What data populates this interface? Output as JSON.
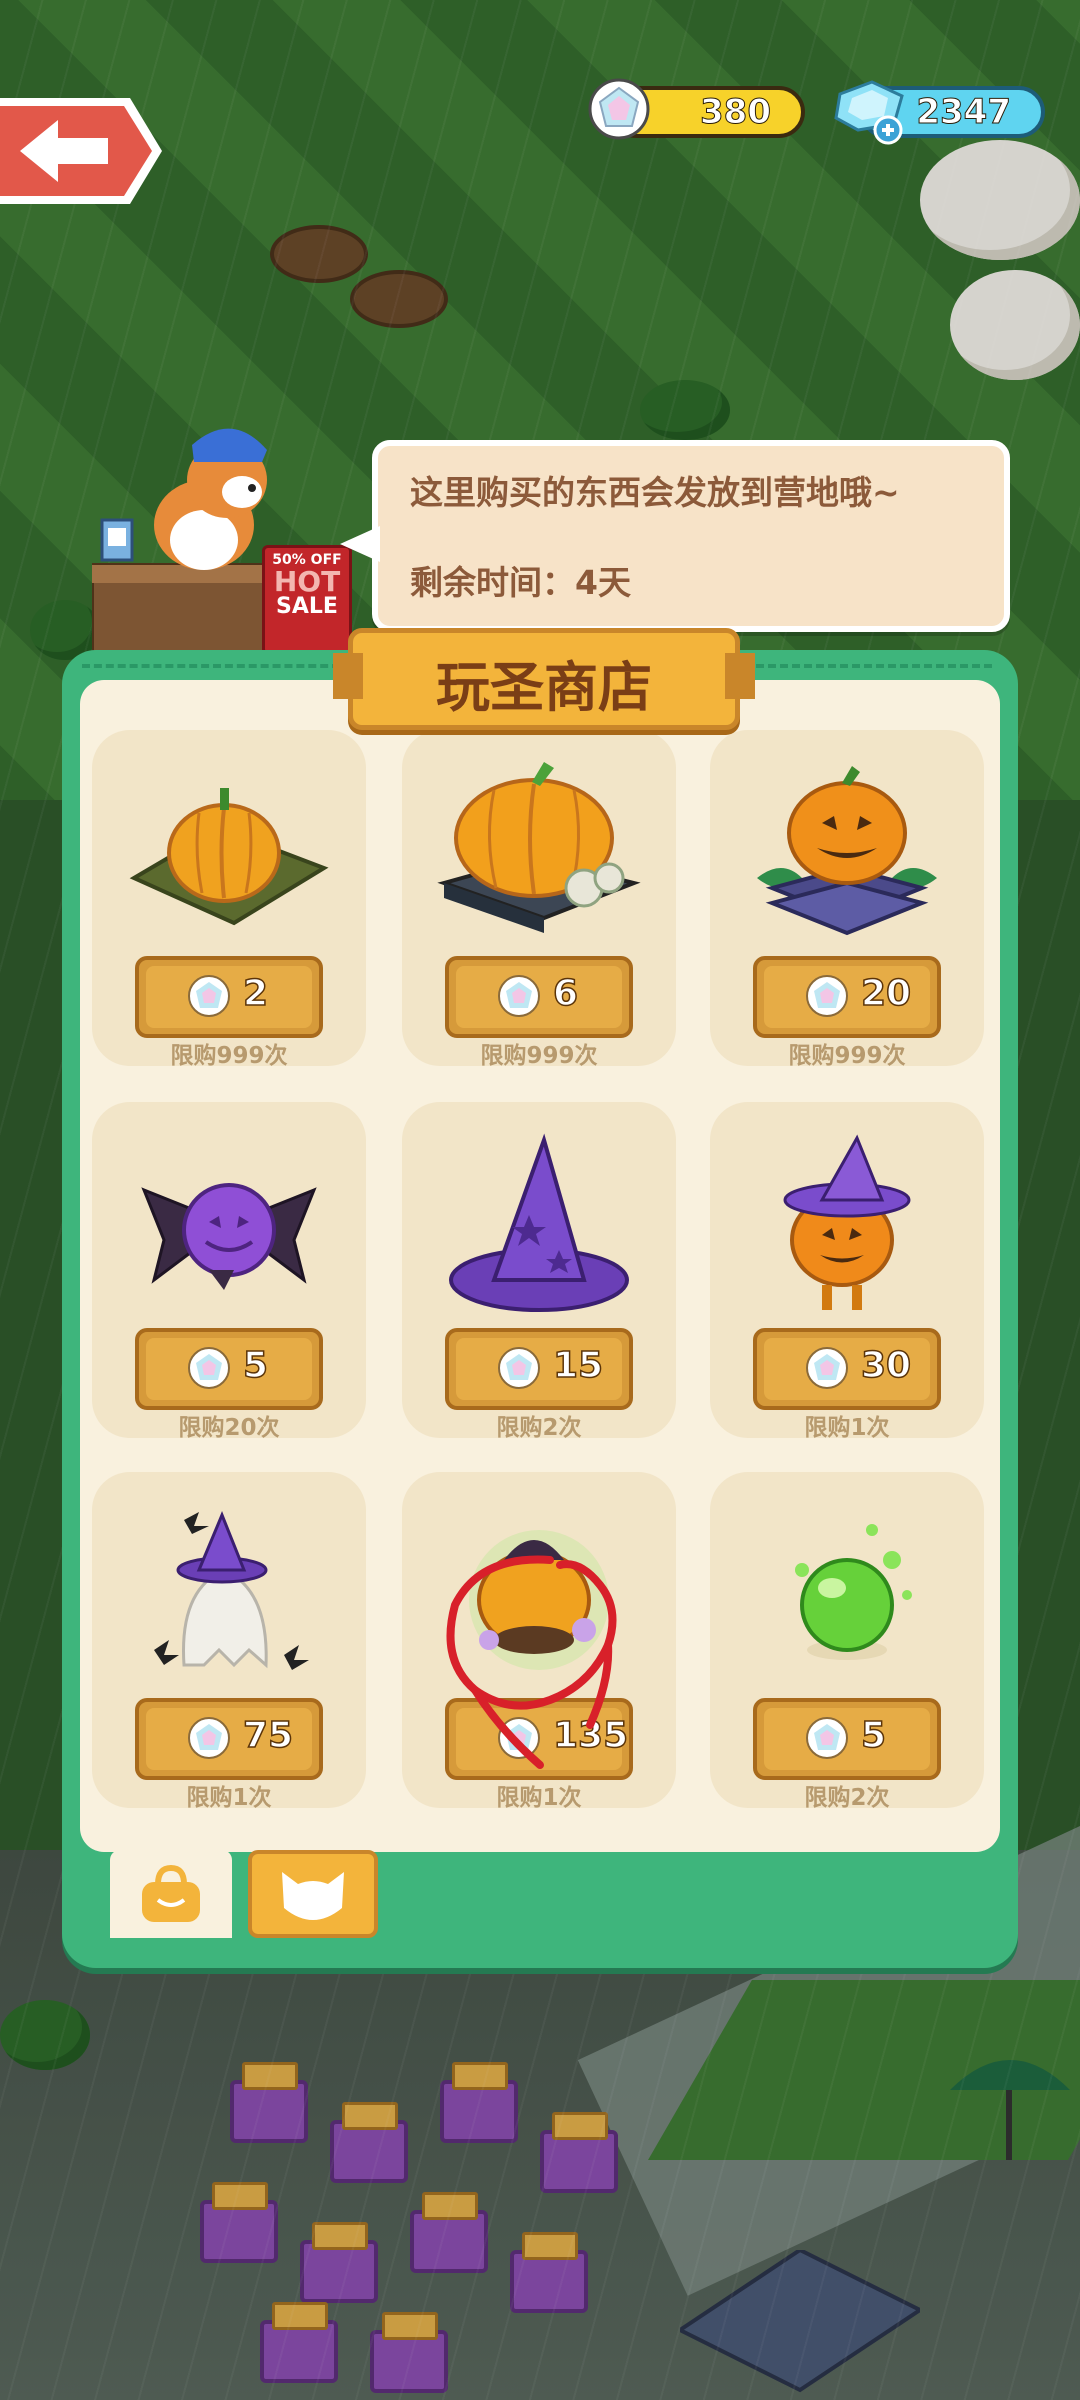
{
  "hud": {
    "back_label": "back",
    "coins": "380",
    "gems": "2347",
    "colors": {
      "coin_bar": "#f7d22a",
      "gem_bar": "#5fd4f0"
    }
  },
  "notice": {
    "line1": "这里购买的东西会发放到营地哦~",
    "line2": "剩余时间：4天"
  },
  "sign": {
    "badge": "50% OFF",
    "text1": "HOT",
    "text2": "SALE"
  },
  "shop": {
    "title": "玩圣商店",
    "items": [
      {
        "icon": "pumpkin-patch-icon",
        "price": "2",
        "limit": "限购999次"
      },
      {
        "icon": "pumpkin-book-icon",
        "price": "6",
        "limit": "限购999次"
      },
      {
        "icon": "jack-o-lantern-book-icon",
        "price": "20",
        "limit": "限购999次"
      },
      {
        "icon": "candy-icon",
        "price": "5",
        "limit": "限购20次"
      },
      {
        "icon": "witch-hat-icon",
        "price": "15",
        "limit": "限购2次"
      },
      {
        "icon": "pumpkin-witch-icon",
        "price": "30",
        "limit": "限购1次"
      },
      {
        "icon": "ghost-witch-icon",
        "price": "75",
        "limit": "限购1次"
      },
      {
        "icon": "cauldron-creature-icon",
        "price": "135",
        "limit": "限购1次"
      },
      {
        "icon": "green-orb-icon",
        "price": "5",
        "limit": "限购2次"
      }
    ],
    "tabs": [
      {
        "icon": "shopping-bag-icon"
      },
      {
        "icon": "cat-face-icon"
      }
    ]
  }
}
